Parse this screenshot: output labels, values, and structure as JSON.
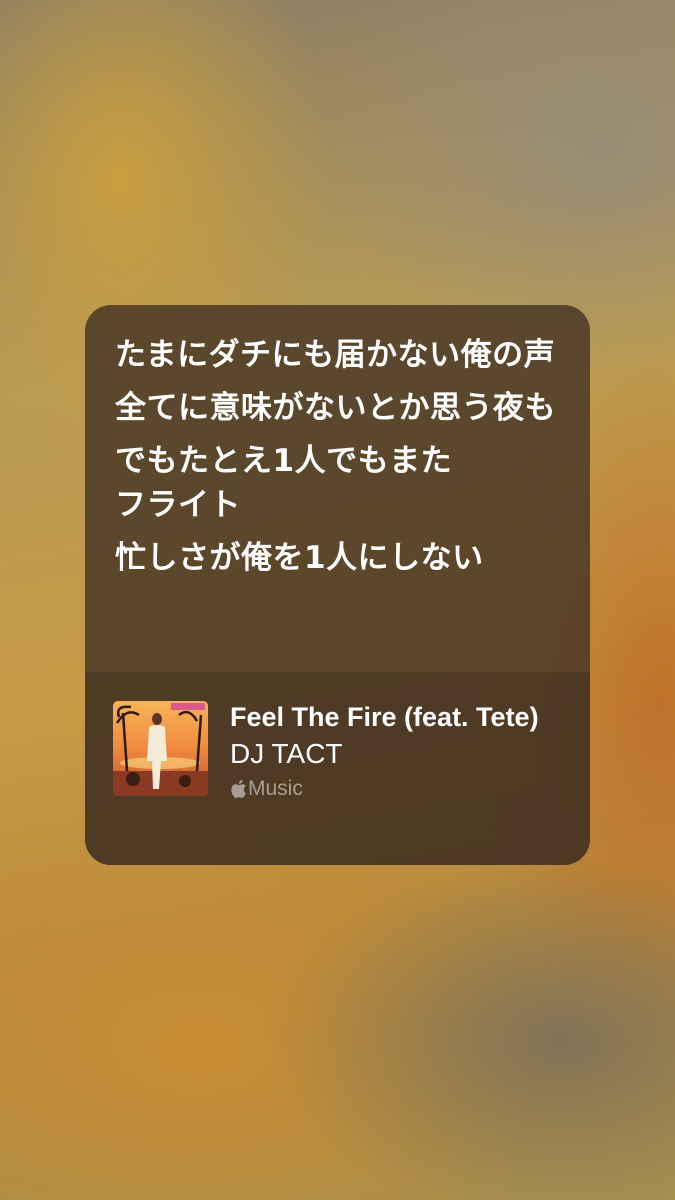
{
  "lyrics": {
    "lines": [
      "たまにダチにも届かない俺の声",
      "全てに意味がないとか思う夜も",
      "でもたとえ1人でもまた\nフライト",
      "忙しさが俺を1人にしない"
    ]
  },
  "track": {
    "title": "Feel The Fire (feat. Tete)",
    "artist": "DJ TACT",
    "service_label": "Music",
    "service_icon": "apple-logo-icon"
  }
}
